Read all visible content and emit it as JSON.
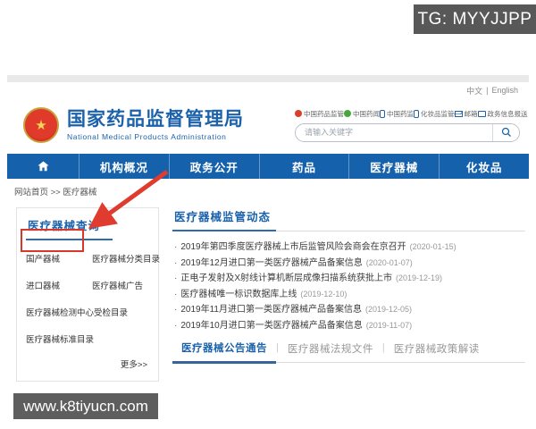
{
  "overlay": {
    "tg_badge": "TG: MYYJJPP",
    "watermark": "www.k8tiyucn.com"
  },
  "colors": {
    "nav_blue": "#1561ac",
    "title_blue": "#1b62ab",
    "annotation_red": "#d8382c",
    "badge_gray": "#585858"
  },
  "topbar": {
    "lang_zh": "中文",
    "lang_sep": "|",
    "lang_en": "English"
  },
  "header": {
    "title": "国家药品监督管理局",
    "subtitle": "National Medical Products Administration",
    "emblem_star": "★",
    "quick_links": [
      {
        "label": "中国药品监管"
      },
      {
        "label": "中国药闻"
      },
      {
        "label": "中国药监"
      },
      {
        "label": "化妆品监管"
      },
      {
        "label": "邮箱"
      },
      {
        "label": "政务信息报送"
      }
    ],
    "search": {
      "placeholder": "请输入关键字"
    }
  },
  "nav": {
    "items": [
      "机构概况",
      "政务公开",
      "药品",
      "医疗器械",
      "化妆品"
    ]
  },
  "breadcrumb": "网站首页 >> 医疗器械",
  "sidebar": {
    "title": "医疗器械查询",
    "items": [
      {
        "label": "国产器械"
      },
      {
        "label": "医疗器械分类目录"
      },
      {
        "label": "进口器械"
      },
      {
        "label": "医疗器械广告"
      },
      {
        "label": "医疗器械检测中心受检目录"
      },
      {
        "label": "医疗器械标准目录"
      }
    ],
    "more": "更多>>"
  },
  "main": {
    "section_title": "医疗器械监管动态",
    "bullet": "·",
    "news": [
      {
        "title": "2019年第四季度医疗器械上市后监管风险会商会在京召开",
        "date": "(2020-01-15)"
      },
      {
        "title": "2019年12月进口第一类医疗器械产品备案信息",
        "date": "(2020-01-07)"
      },
      {
        "title": "正电子发射及X射线计算机断层成像扫描系统获批上市",
        "date": "(2019-12-19)"
      },
      {
        "title": "医疗器械唯一标识数据库上线",
        "date": "(2019-12-10)"
      },
      {
        "title": "2019年11月进口第一类医疗器械产品备案信息",
        "date": "(2019-12-05)"
      },
      {
        "title": "2019年10月进口第一类医疗器械产品备案信息",
        "date": "(2019-11-07)"
      }
    ],
    "tab_separator": "|",
    "tabs": [
      {
        "label": "医疗器械公告通告"
      },
      {
        "label": "医疗器械法规文件"
      },
      {
        "label": "医疗器械政策解读"
      }
    ]
  }
}
